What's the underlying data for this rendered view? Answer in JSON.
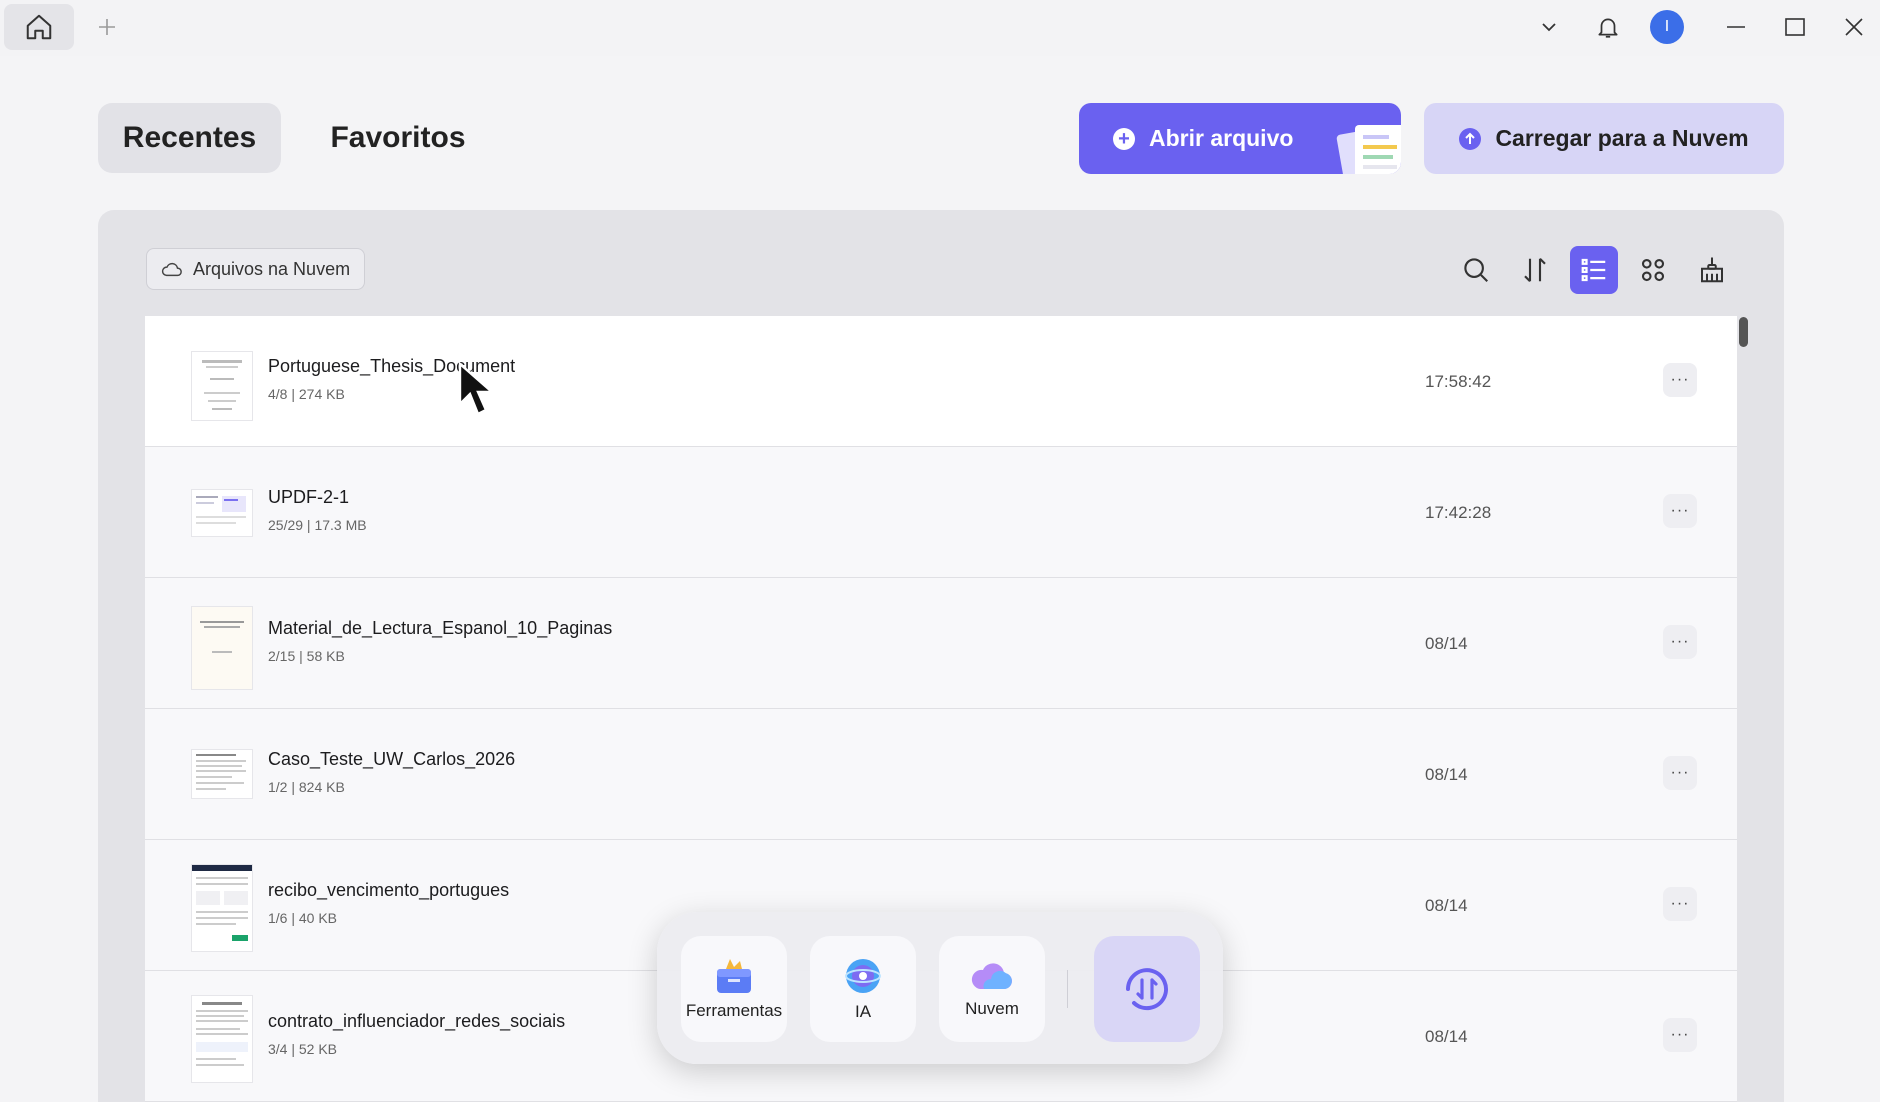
{
  "tabs": {
    "recentes": "Recentes",
    "favoritos": "Favoritos"
  },
  "actions": {
    "open_file": "Abrir arquivo",
    "upload_cloud": "Carregar para a Nuvem"
  },
  "avatar_initial": "I",
  "panel": {
    "cloud_files_label": "Arquivos na Nuvem"
  },
  "files": [
    {
      "name": "Portuguese_Thesis_Document",
      "meta": "4/8 | 274 KB",
      "time": "17:58:42"
    },
    {
      "name": "UPDF-2-1",
      "meta": "25/29 | 17.3 MB",
      "time": "17:42:28"
    },
    {
      "name": "Material_de_Lectura_Espanol_10_Paginas",
      "meta": "2/15 | 58 KB",
      "time": "08/14"
    },
    {
      "name": "Caso_Teste_UW_Carlos_2026",
      "meta": "1/2 | 824 KB",
      "time": "08/14"
    },
    {
      "name": "recibo_vencimento_portugues",
      "meta": "1/6 | 40 KB",
      "time": "08/14"
    },
    {
      "name": "contrato_influenciador_redes_sociais",
      "meta": "3/4 | 52 KB",
      "time": "08/14"
    }
  ],
  "more_glyph": "···",
  "dock": {
    "tools": "Ferramentas",
    "ai": "IA",
    "cloud": "Nuvem"
  },
  "colors": {
    "accent": "#6a61f0",
    "accent_light": "#d7d5f6",
    "panel_bg": "#e3e3e7"
  }
}
